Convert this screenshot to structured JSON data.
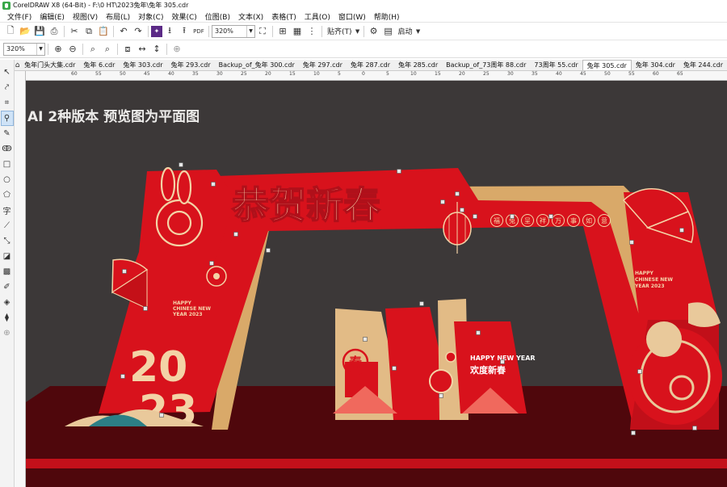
{
  "window": {
    "title": "CorelDRAW X8 (64-Bit) - F:\\0 HT\\2023兔年\\兔年 305.cdr"
  },
  "menu": {
    "items": [
      "文件(F)",
      "编辑(E)",
      "视图(V)",
      "布局(L)",
      "对象(C)",
      "效果(C)",
      "位图(B)",
      "文本(X)",
      "表格(T)",
      "工具(O)",
      "窗口(W)",
      "帮助(H)"
    ]
  },
  "toolbar": {
    "zoom": "320%",
    "snap_label": "贴齐(T)",
    "launch_label": "启动"
  },
  "property_bar": {
    "zoom": "320%"
  },
  "tabs": {
    "items": [
      "兔年门头大集.cdr",
      "兔年 6.cdr",
      "兔年 303.cdr",
      "兔年 293.cdr",
      "Backup_of_兔年 300.cdr",
      "兔年 297.cdr",
      "兔年 287.cdr",
      "兔年 285.cdr",
      "Backup_of_73周年 88.cdr",
      "73周年 55.cdr",
      "兔年 305.cdr",
      "兔年 304.cdr",
      "兔年 244.cdr"
    ],
    "active": "兔年 305.cdr"
  },
  "ruler": {
    "labels": [
      "60",
      "55",
      "50",
      "45",
      "40",
      "35",
      "30",
      "25",
      "20",
      "15",
      "10",
      "5",
      "0",
      "5",
      "10",
      "15",
      "20",
      "25",
      "30",
      "35",
      "40",
      "45",
      "50",
      "55",
      "60",
      "65"
    ]
  },
  "canvas": {
    "caption": "AI 2种版本   预览图为平面图",
    "headline": "恭贺新春",
    "blessing_chars": [
      "福",
      "兔",
      "呈",
      "祥",
      "万",
      "事",
      "如",
      "意"
    ],
    "year_big": [
      "20",
      "23"
    ],
    "english_small": [
      "HAPPY",
      "CHINESE NEW",
      "YEAR 2023"
    ],
    "english_right": [
      "HAPPY",
      "CHINESE NEW",
      "YEAR 2023"
    ],
    "center_english": "HAPPY NEW YEAR",
    "center_chinese": "欢度新春",
    "chun_char": "春",
    "colors": {
      "background": "#3c3838",
      "red": "#d8121c",
      "gold": "#e9c99b",
      "dark_red": "#8e0a12",
      "floor": "#5a0a0f"
    }
  }
}
